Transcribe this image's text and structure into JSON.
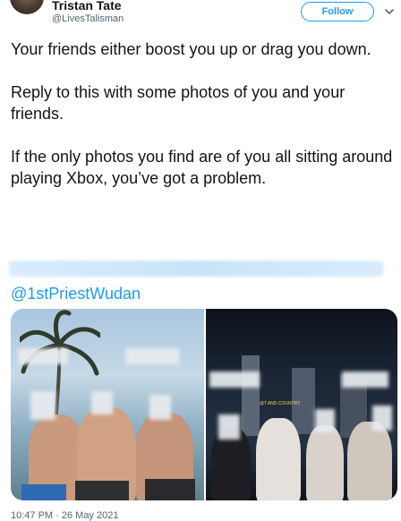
{
  "author": {
    "name": "Tristan Tate",
    "handle": "@LivesTalisman"
  },
  "header": {
    "follow_label": "Follow"
  },
  "tweet": {
    "paragraphs": [
      "Your friends either boost you up or drag you down.",
      "Reply to this with some photos of you and your friends.",
      "If the only photos you find are of you all sitting around playing Xbox, you’ve got a problem."
    ],
    "mention": "@1stPriestWudan"
  },
  "media": {
    "right_photo_tag": "@T.AND.COUNTRY"
  },
  "timestamp": "10:47 PM · 26 May 2021",
  "colors": {
    "accent": "#1d9bf0",
    "text": "#0f1419",
    "secondary": "#536471"
  }
}
